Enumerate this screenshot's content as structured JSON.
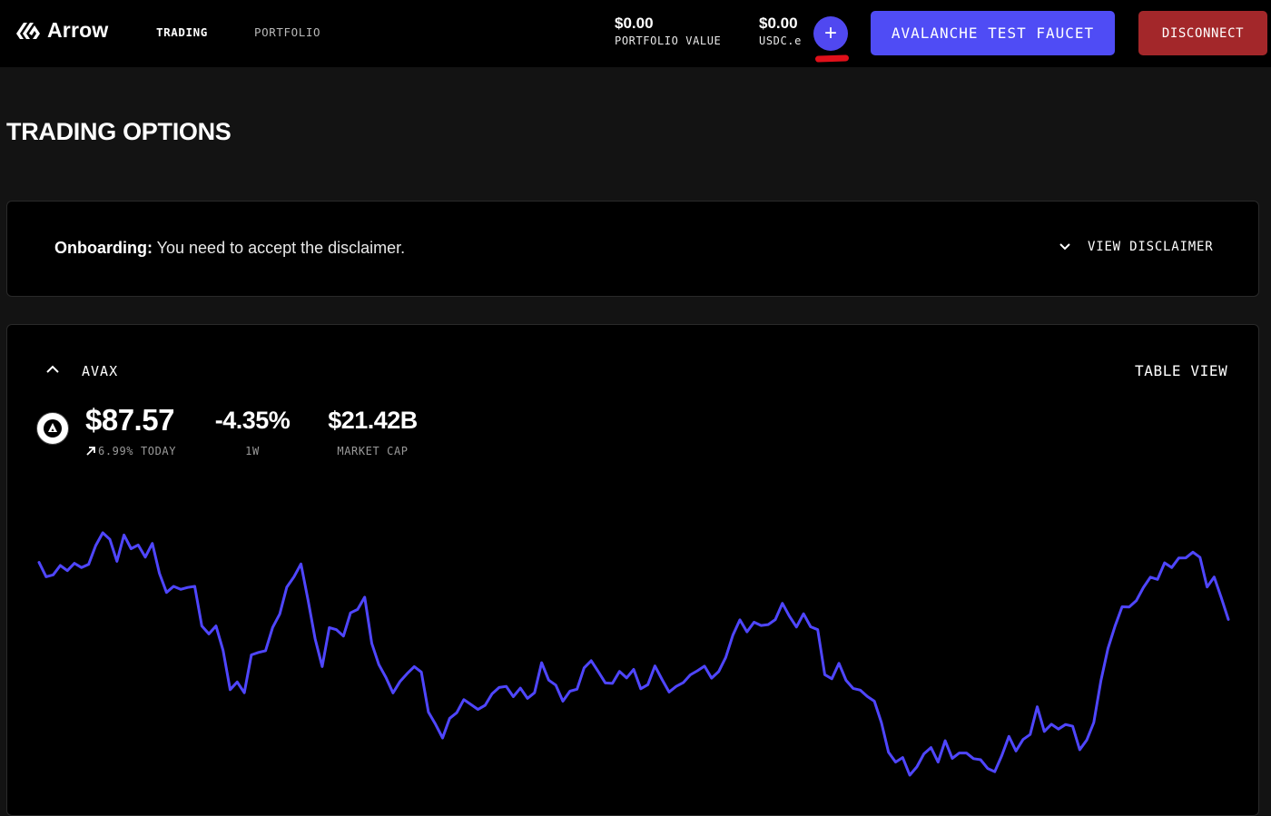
{
  "brand": {
    "name": "Arrow"
  },
  "nav": {
    "trading_label": "TRADING",
    "portfolio_label": "PORTFOLIO"
  },
  "header": {
    "portfolio_value": "$0.00",
    "portfolio_value_label": "PORTFOLIO VALUE",
    "usdc_value": "$0.00",
    "usdc_label": "USDC.e",
    "add_funds_symbol": "+",
    "faucet_button_label": "AVALANCHE TEST FAUCET",
    "disconnect_button_label": "DISCONNECT"
  },
  "page": {
    "title": "TRADING OPTIONS"
  },
  "onboarding": {
    "label": "Onboarding:",
    "message": " You need to accept the disclaimer.",
    "toggle_label": "VIEW DISCLAIMER"
  },
  "asset": {
    "name": "AVAX",
    "table_view_label": "TABLE VIEW",
    "price": "$87.57",
    "today_change": "6.99% TODAY",
    "week_change": "-4.35%",
    "week_label": "1W",
    "market_cap": "$21.42B",
    "market_cap_label": "MARKET CAP",
    "icon": "avalanche-icon"
  },
  "colors": {
    "accent": "#4f4cf5",
    "disconnect": "#a3272a",
    "chart_line": "#4f46ff",
    "annotation_mark": "#e0101a"
  },
  "chart_data": {
    "type": "line",
    "title": "",
    "xlabel": "",
    "ylabel": "",
    "series": [
      {
        "values": [
          97.35,
          96.69,
          96.78,
          97.21,
          96.97,
          97.31,
          97.11,
          97.26,
          98.12,
          98.71,
          98.41,
          97.4,
          98.61,
          97.98,
          98.15,
          97.59,
          98.22,
          96.85,
          95.97,
          96.25,
          96.11,
          96.2,
          96.25,
          94.43,
          94.06,
          94.43,
          93.31,
          91.5,
          91.85,
          91.36,
          93.1,
          93.21,
          93.29,
          94.36,
          94.97,
          96.21,
          96.68,
          97.28,
          95.62,
          93.84,
          92.56,
          94.35,
          94.26,
          93.96,
          95.03,
          95.19,
          95.75,
          93.63,
          92.65,
          92.06,
          91.35,
          91.88,
          92.24,
          92.56,
          92.31,
          90.47,
          89.91,
          89.28,
          90.18,
          90.44,
          91.04,
          90.82,
          90.59,
          90.78,
          91.31,
          91.6,
          91.65,
          91.18,
          91.57,
          91.1,
          91.36,
          92.74,
          91.94,
          91.71,
          90.97,
          91.43,
          91.52,
          92.5,
          92.83,
          92.33,
          91.81,
          91.79,
          92.34,
          92.04,
          92.43,
          91.54,
          91.73,
          92.59,
          91.97,
          91.39,
          91.65,
          91.82,
          92.18,
          92.37,
          92.58,
          92.03,
          92.33,
          92.98,
          94.0,
          94.71,
          94.16,
          94.6,
          94.45,
          94.49,
          94.72,
          95.47,
          94.88,
          94.38,
          94.99,
          94.39,
          94.26,
          92.19,
          92.0,
          92.71,
          91.93,
          91.56,
          91.48,
          91.19,
          90.97,
          89.98,
          88.62,
          88.17,
          88.38,
          87.57,
          87.95,
          88.55,
          88.84,
          88.17,
          89.15,
          88.34,
          88.59,
          88.59,
          88.33,
          88.28,
          87.88,
          87.73,
          88.47,
          89.35,
          88.68,
          89.21,
          89.44,
          90.71,
          89.58,
          89.91,
          89.69,
          89.9,
          89.82,
          88.74,
          89.18,
          89.99,
          91.9,
          93.39,
          94.42,
          95.31,
          95.3,
          95.59,
          96.19,
          96.67,
          96.57,
          97.33,
          97.11,
          97.55,
          97.56,
          97.82,
          97.58,
          96.22,
          96.68,
          95.73,
          94.73
        ],
        "color": "#4f46ff"
      }
    ]
  }
}
